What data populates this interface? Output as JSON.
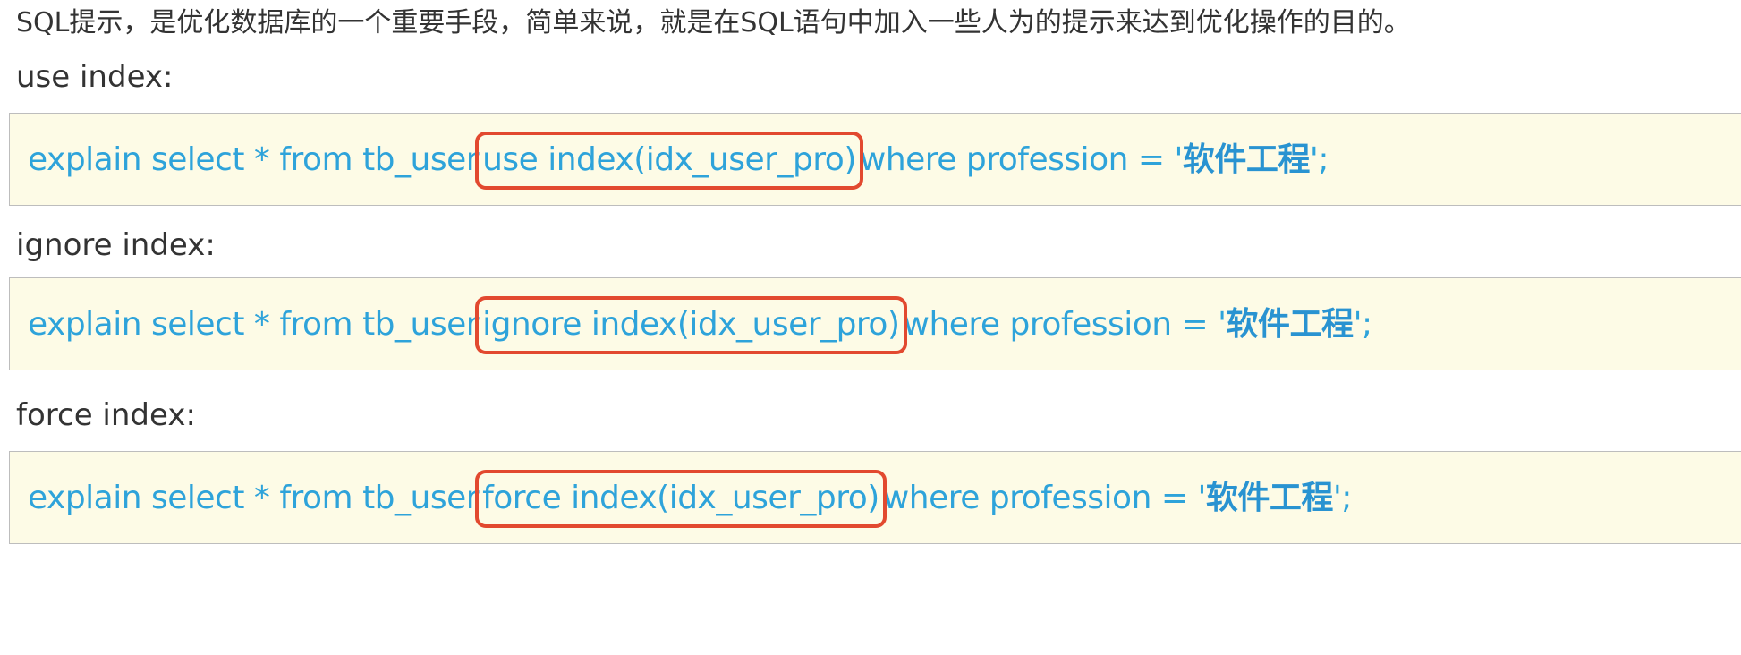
{
  "intro": {
    "text": "SQL提示，是优化数据库的一个重要手段，简单来说，就是在SQL语句中加入一些人为的提示来达到优化操作的目的。"
  },
  "sections": [
    {
      "label": "use index:",
      "code": {
        "prefix": "explain select * from tb_user",
        "hint": "use index(idx_user_pro)",
        "middle": "where profession = '",
        "string": "软件工程",
        "suffix": "';"
      }
    },
    {
      "label": "ignore index:",
      "code": {
        "prefix": "explain select * from tb_user",
        "hint": "ignore index(idx_user_pro)",
        "middle": "where profession = '",
        "string": "软件工程",
        "suffix": "';"
      }
    },
    {
      "label": "force index:",
      "code": {
        "prefix": "explain select * from tb_user",
        "hint": "force index(idx_user_pro)",
        "middle": "where profession = '",
        "string": "软件工程",
        "suffix": "';"
      }
    }
  ],
  "colors": {
    "code_text": "#2ea3da",
    "code_background": "#fdfbe6",
    "highlight_border": "#e2492f"
  }
}
